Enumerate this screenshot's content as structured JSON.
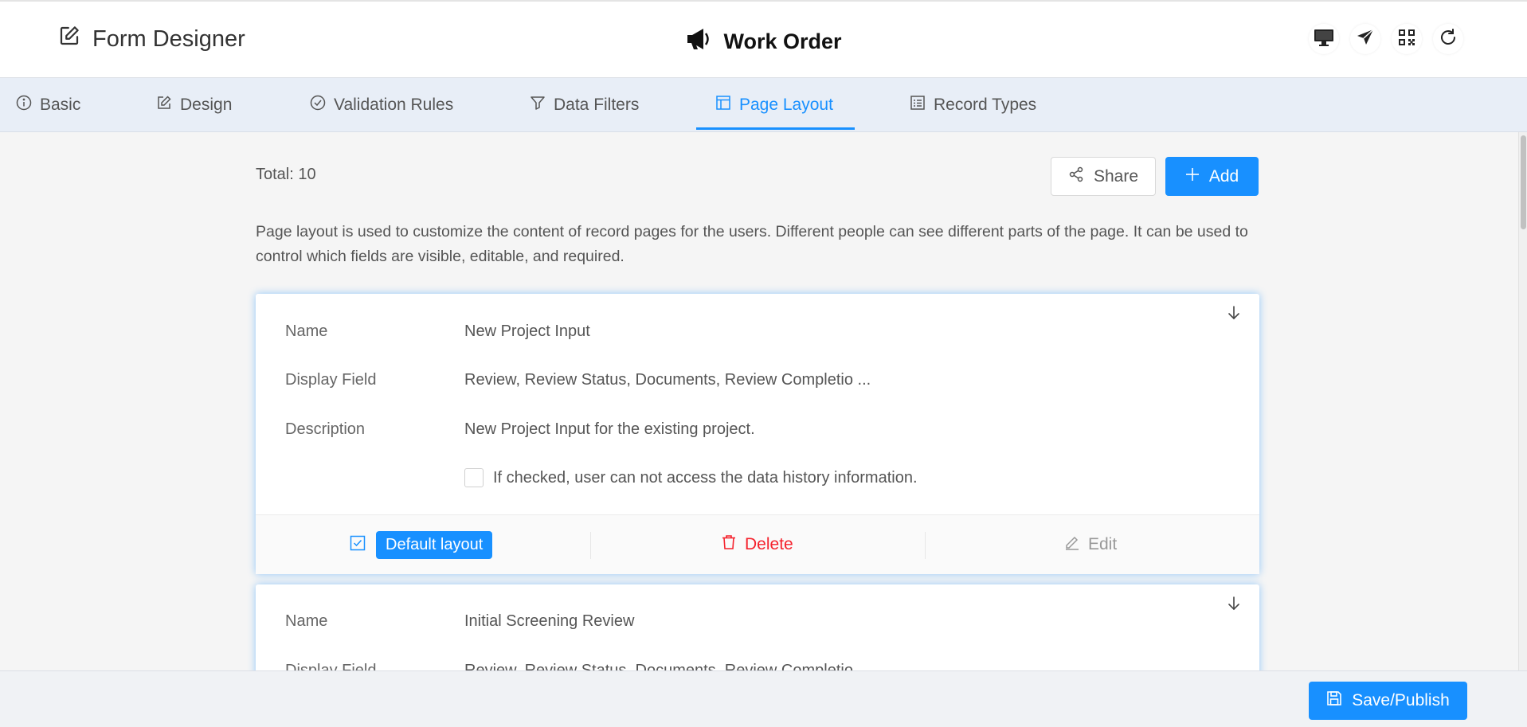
{
  "header": {
    "app_title": "Form Designer",
    "form_title": "Work Order",
    "tools": [
      "desktop-icon",
      "send-icon",
      "qrcode-icon",
      "refresh-icon"
    ]
  },
  "tabs": [
    {
      "label": "Basic",
      "icon": "info-icon"
    },
    {
      "label": "Design",
      "icon": "edit-icon"
    },
    {
      "label": "Validation Rules",
      "icon": "check-circle-icon"
    },
    {
      "label": "Data Filters",
      "icon": "filter-icon"
    },
    {
      "label": "Page Layout",
      "icon": "layout-icon",
      "active": true
    },
    {
      "label": "Record Types",
      "icon": "list-icon"
    }
  ],
  "toolbar": {
    "total": "Total: 10",
    "share_label": "Share",
    "add_label": "Add"
  },
  "description": "Page layout is used to customize the content of record pages for the users. Different people can see different parts of the page. It can be used to control which fields are visible, editable, and required.",
  "layouts": [
    {
      "name_label": "Name",
      "name": "New Project Input",
      "display_label": "Display Field",
      "display": "Review, Review Status, Documents, Review Completio ...",
      "desc_label": "Description",
      "desc": "New Project Input for the existing project.",
      "history_note": "If checked, user can not access the data history information.",
      "history_checked": false,
      "default_label": "Default layout",
      "is_default": true,
      "delete_label": "Delete",
      "edit_label": "Edit"
    },
    {
      "name_label": "Name",
      "name": "Initial Screening Review",
      "display_label": "Display Field",
      "display": "Review, Review Status, Documents, Review Completio ..."
    }
  ],
  "footer": {
    "save_label": "Save/Publish"
  },
  "colors": {
    "accent": "#1890ff",
    "danger": "#f5222d",
    "tabbar": "#e8eef7"
  }
}
